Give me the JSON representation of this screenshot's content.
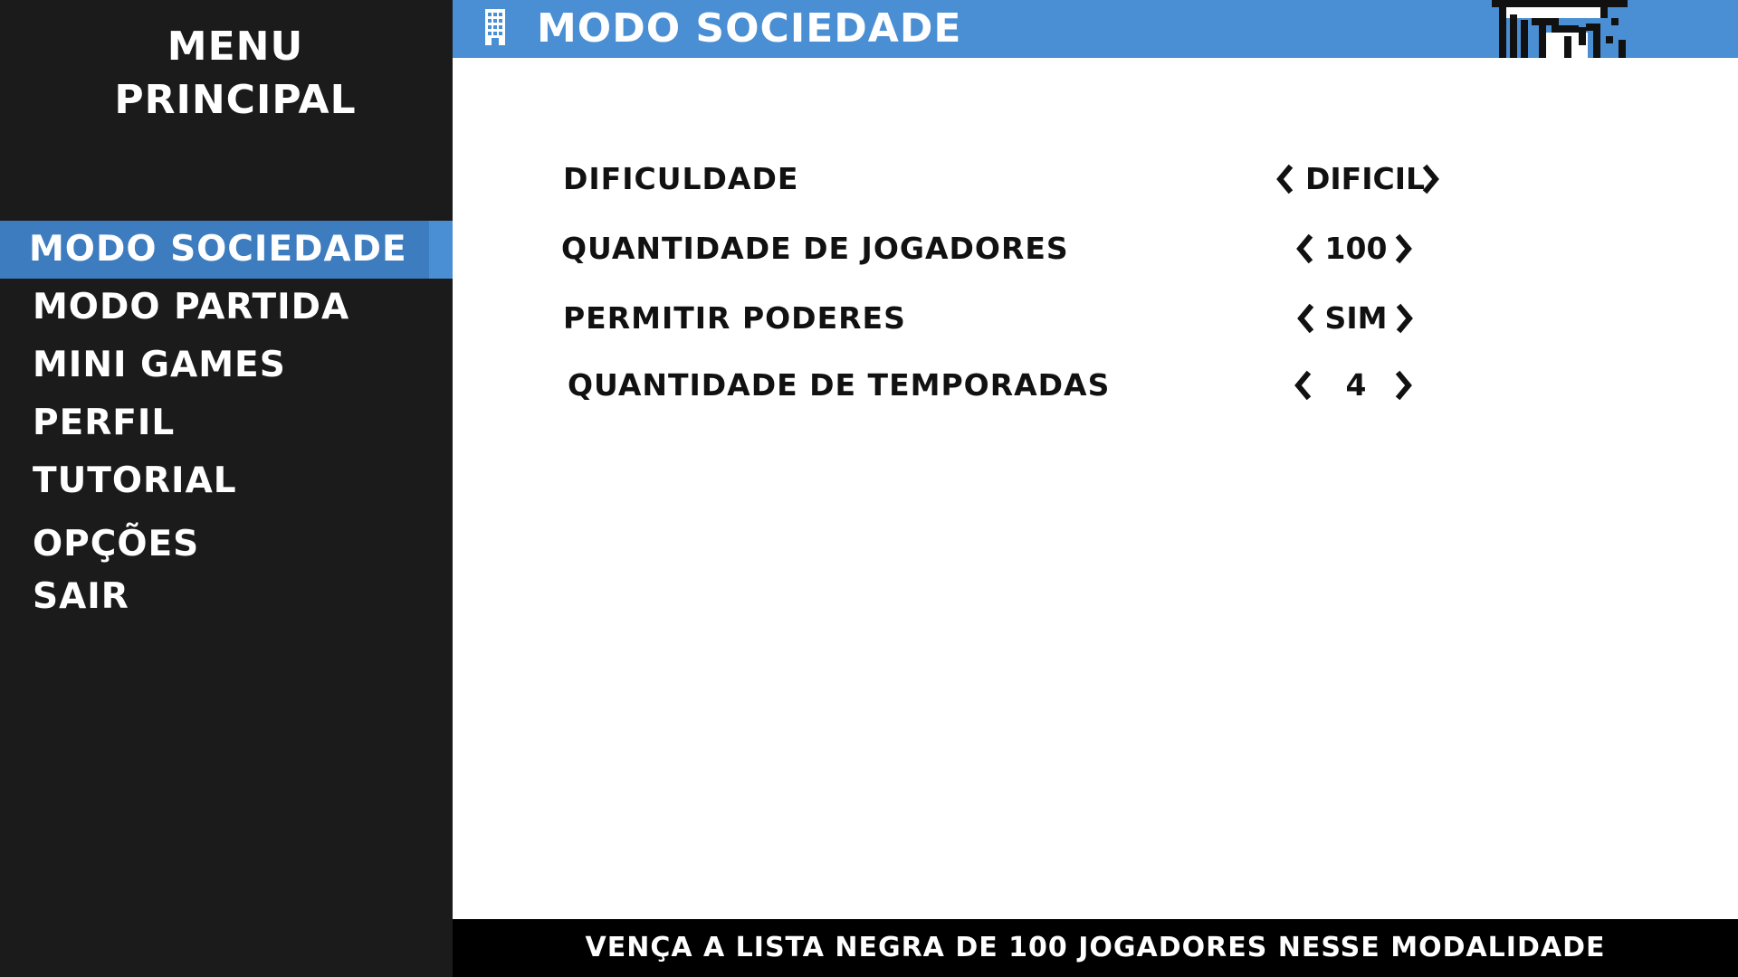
{
  "sidebar": {
    "title_line1": "MENU",
    "title_line2": "PRINCIPAL",
    "items": [
      {
        "label": "MODO SOCIEDADE",
        "active": true
      },
      {
        "label": "MODO PARTIDA"
      },
      {
        "label": "MINI GAMES"
      },
      {
        "label": "PERFIL"
      },
      {
        "label": "TUTORIAL"
      },
      {
        "label": "OPÇÕES"
      },
      {
        "label": "SAIR"
      }
    ]
  },
  "header": {
    "title": "MODO SOCIEDADE",
    "icon": "building-icon",
    "mascot": "pixel-character-icon"
  },
  "settings": [
    {
      "label": "DIFICULDADE",
      "value": "DIFICIL"
    },
    {
      "label": "QUANTIDADE DE JOGADORES",
      "value": "100"
    },
    {
      "label": "PERMITIR PODERES",
      "value": "SIM"
    },
    {
      "label": "QUANTIDADE DE TEMPORADAS",
      "value": "4"
    }
  ],
  "footer": {
    "text": "VENÇA A LISTA NEGRA DE 100 JOGADORES NESSE MODALIDADE"
  },
  "colors": {
    "sidebar_bg": "#1b1b1b",
    "header_bg": "#4a8fd3",
    "active_item_bg": "#3d7cbe",
    "footer_bg": "#000000"
  }
}
